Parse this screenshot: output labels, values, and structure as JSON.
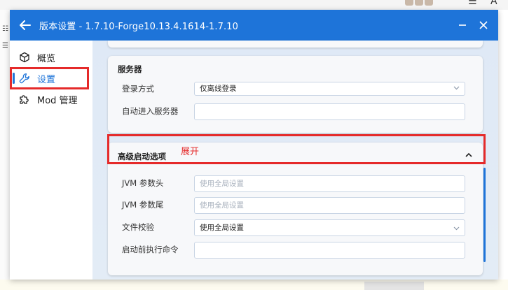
{
  "window": {
    "title": "版本设置 - 1.7.10-Forge10.13.4.1614-1.7.10"
  },
  "sidebar": {
    "items": [
      {
        "label": "概览",
        "icon": "cube-icon"
      },
      {
        "label": "设置",
        "icon": "wrench-icon",
        "active": true
      },
      {
        "label": "Mod 管理",
        "icon": "puzzle-icon"
      }
    ]
  },
  "server_section": {
    "title": "服务器",
    "login_label": "登录方式",
    "login_value": "仅离线登录",
    "auto_join_label": "自动进入服务器",
    "auto_join_value": ""
  },
  "advanced_section": {
    "title": "高级启动选项",
    "jvm_head_label": "JVM 参数头",
    "jvm_head_placeholder": "使用全局设置",
    "jvm_tail_label": "JVM 参数尾",
    "jvm_tail_placeholder": "使用全局设置",
    "file_check_label": "文件校验",
    "file_check_value": "使用全局设置",
    "pre_launch_label": "启动前执行命令",
    "pre_launch_value": ""
  },
  "annotation": {
    "expand_text": "展开",
    "color": "#e52a2a"
  },
  "colors": {
    "accent": "#1e74d9",
    "window_bg": "#dde8f5"
  }
}
